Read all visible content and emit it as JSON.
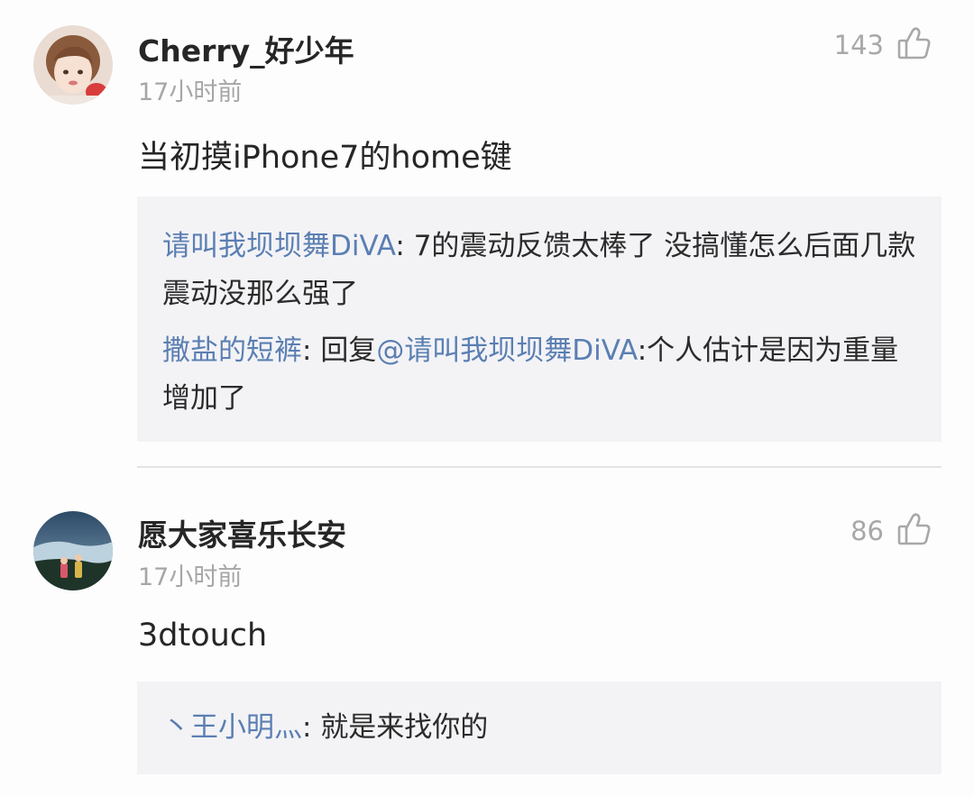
{
  "comments": [
    {
      "username": "Cherry_好少年",
      "time": "17小时前",
      "likes": "143",
      "text": "当初摸iPhone7的home键",
      "replies": [
        {
          "user": "请叫我坝坝舞DiVA",
          "sep": ": ",
          "text": "7的震动反馈太棒了 没搞懂怎么后面几款震动没那么强了"
        },
        {
          "user": "撒盐的短裤",
          "sep": ": ",
          "prefix": "回复",
          "mention": "@请叫我坝坝舞DiVA",
          "text": ":个人估计是因为重量增加了"
        }
      ]
    },
    {
      "username": "愿大家喜乐长安",
      "time": "17小时前",
      "likes": "86",
      "text": "3dtouch",
      "replies": [
        {
          "user": "丶王小明灬",
          "sep": ": ",
          "text": "就是来找你的"
        }
      ]
    }
  ],
  "icons": {
    "like": "thumbs-up-outline-icon"
  },
  "colors": {
    "link": "#5b7fb2",
    "reply_bg": "#f3f3f6",
    "meta": "#a6a6a6"
  }
}
